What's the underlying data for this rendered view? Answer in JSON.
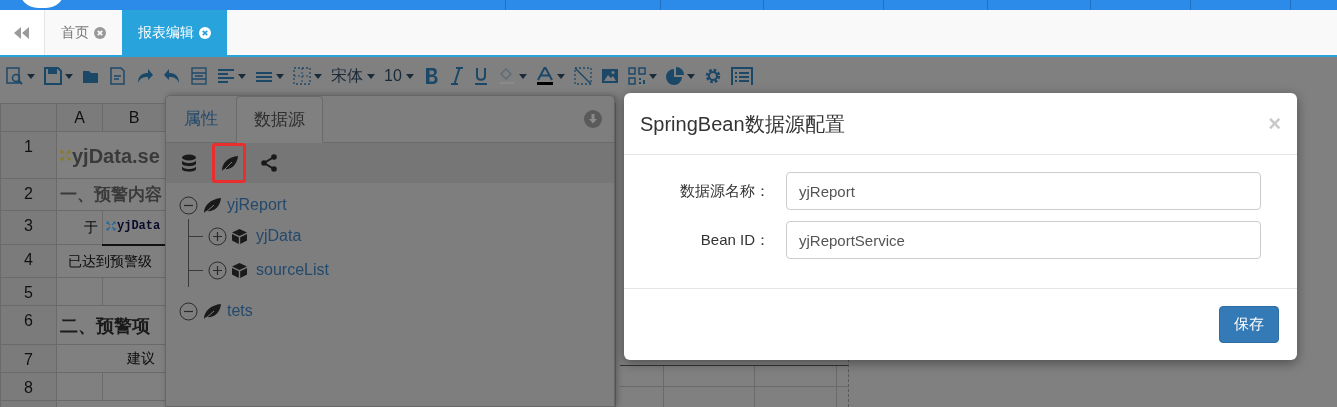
{
  "tabs": [
    {
      "label": "首页",
      "selected": false
    },
    {
      "label": "报表编辑",
      "selected": true
    }
  ],
  "toolbar": {
    "font": "宋体",
    "size": "10"
  },
  "sheet": {
    "columns": [
      "A",
      "B"
    ],
    "rows": [
      {
        "number": "1",
        "cells": [
          {
            "kind": "title",
            "text": "yjData.se",
            "colspan": 2
          }
        ]
      },
      {
        "number": "2",
        "cells": [
          {
            "kind": "heading",
            "text": "一、预警内容",
            "colspan": 2
          }
        ]
      },
      {
        "number": "3",
        "cells": [
          {
            "kind": "prefix",
            "text": "于"
          },
          {
            "kind": "expression",
            "text": "yjData"
          }
        ]
      },
      {
        "number": "4",
        "cells": [
          {
            "kind": "sentence",
            "text": "已达到预警级",
            "colspan": 2
          }
        ]
      },
      {
        "number": "5",
        "cells": []
      },
      {
        "number": "6",
        "cells": [
          {
            "kind": "heading_serif",
            "text": "二、预警项",
            "colspan": 2
          }
        ]
      },
      {
        "number": "7",
        "cells": [
          {
            "kind": "suggestion",
            "text": "建议",
            "colspan": 2
          }
        ]
      },
      {
        "number": "8",
        "cells": []
      }
    ]
  },
  "panel": {
    "tabs": [
      {
        "label": "属性",
        "selected": false
      },
      {
        "label": "数据源",
        "selected": true
      }
    ],
    "tools": [
      {
        "kind": "database",
        "highlighted": false
      },
      {
        "kind": "bean",
        "highlighted": true
      },
      {
        "kind": "share",
        "highlighted": false
      }
    ],
    "tree": [
      {
        "kind": "source",
        "label": "yjReport",
        "expanded": true,
        "children": [
          {
            "kind": "dataset",
            "label": "yjData",
            "expanded": false
          },
          {
            "kind": "dataset",
            "label": "sourceList",
            "expanded": false
          }
        ]
      },
      {
        "kind": "source",
        "label": "tets",
        "expanded": true
      }
    ]
  },
  "dialog": {
    "title": "SpringBean数据源配置",
    "close": "×",
    "fields": [
      {
        "label": "数据源名称：",
        "value": "yjReport"
      },
      {
        "label": "Bean ID：",
        "value": "yjReportService"
      }
    ],
    "buttons": [
      "保存"
    ]
  }
}
